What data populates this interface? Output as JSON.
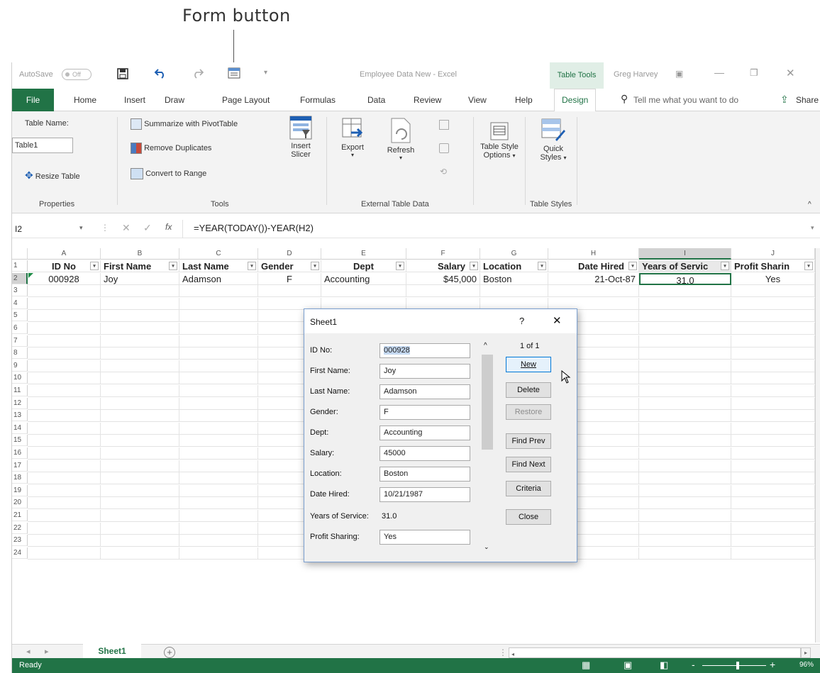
{
  "caption": {
    "label": "Form button"
  },
  "qat": {
    "autosave": "AutoSave",
    "autosave_state": "Off",
    "doc_title": "Employee Data New - Excel",
    "context_tab": "Table Tools",
    "user": "Greg Harvey"
  },
  "tabs": [
    "File",
    "Home",
    "Insert",
    "Draw",
    "Page Layout",
    "Formulas",
    "Data",
    "Review",
    "View",
    "Help",
    "Design"
  ],
  "tell_me": "Tell me what you want to do",
  "share": "Share",
  "ribbon": {
    "table_name_label": "Table Name:",
    "table_name_value": "Table1",
    "resize_table": "Resize Table",
    "properties_group": "Properties",
    "summarize": "Summarize with PivotTable",
    "remove_dup": "Remove Duplicates",
    "convert": "Convert to Range",
    "tools_group": "Tools",
    "insert_slicer_1": "Insert",
    "insert_slicer_2": "Slicer",
    "export": "Export",
    "refresh": "Refresh",
    "external_group": "External Table Data",
    "style_options_1": "Table Style",
    "style_options_2": "Options",
    "quick_styles_1": "Quick",
    "quick_styles_2": "Styles",
    "styles_group": "Table Styles"
  },
  "formula_bar": {
    "name_box": "I2",
    "fx": "fx",
    "formula": "=YEAR(TODAY())-YEAR(H2)"
  },
  "columns": [
    "A",
    "B",
    "C",
    "D",
    "E",
    "F",
    "G",
    "H",
    "I",
    "J"
  ],
  "rows": [
    "1",
    "2",
    "3",
    "4",
    "5",
    "6",
    "7",
    "8",
    "9",
    "10",
    "11",
    "12",
    "13",
    "14",
    "15",
    "16",
    "17",
    "18",
    "19",
    "20",
    "21",
    "22",
    "23",
    "24"
  ],
  "headers": [
    "ID No",
    "First Name",
    "Last Name",
    "Gender",
    "Dept",
    "Salary",
    "Location",
    "Date Hired",
    "Years of Servic",
    "Profit Sharin"
  ],
  "record": [
    "000928",
    "Joy",
    "Adamson",
    "F",
    "Accounting",
    "$45,000",
    "Boston",
    "21-Oct-87",
    "31.0",
    "Yes"
  ],
  "dialog": {
    "title": "Sheet1",
    "help": "?",
    "close": "✕",
    "counter": "1 of 1",
    "fields": [
      {
        "label": "ID No:",
        "value": "000928"
      },
      {
        "label": "First Name:",
        "value": "Joy"
      },
      {
        "label": "Last Name:",
        "value": "Adamson"
      },
      {
        "label": "Gender:",
        "value": "F"
      },
      {
        "label": "Dept:",
        "value": "Accounting"
      },
      {
        "label": "Salary:",
        "value": "45000"
      },
      {
        "label": "Location:",
        "value": "Boston"
      },
      {
        "label": "Date Hired:",
        "value": "10/21/1987"
      },
      {
        "label": "Years of Service:",
        "value": "31.0"
      },
      {
        "label": "Profit Sharing:",
        "value": "Yes"
      }
    ],
    "buttons": {
      "new": "New",
      "delete": "Delete",
      "restore": "Restore",
      "find_prev": "Find Prev",
      "find_next": "Find Next",
      "criteria": "Criteria",
      "close": "Close"
    }
  },
  "sheet_tab": "Sheet1",
  "status": {
    "ready": "Ready",
    "zoom": "96%"
  }
}
